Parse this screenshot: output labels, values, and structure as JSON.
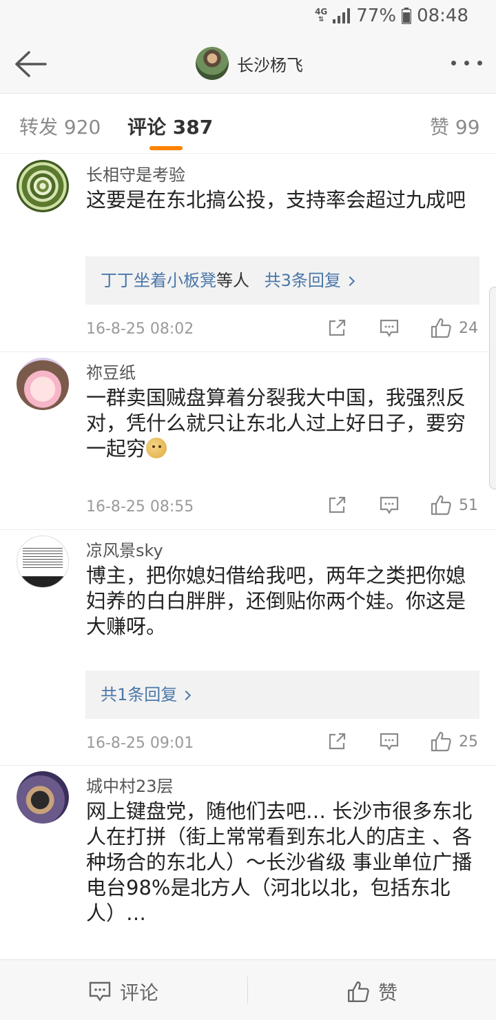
{
  "status_bar": {
    "network": "4G",
    "battery": "77%",
    "time": "08:48"
  },
  "header": {
    "title": "长沙杨飞"
  },
  "tabs": {
    "repost": "转发 920",
    "comments": "评论 387",
    "likes": "赞 99"
  },
  "comments": [
    {
      "user": "长相守是考验",
      "text": "这要是在东北搞公投，支持率会超过九成吧",
      "reply_users": "丁丁坐着小板凳",
      "reply_mid": "等人",
      "reply_count": "共3条回复",
      "time": "16-8-25 08:02",
      "likes": "24"
    },
    {
      "user": "祢豆纸",
      "text": "一群卖国贼盘算着分裂我大中国，我强烈反对，凭什么就只让东北人过上好日子，要穷一起穷",
      "time": "16-8-25 08:55",
      "likes": "51"
    },
    {
      "user": "凉风景sky",
      "text": "博主，把你媳妇借给我吧，两年之类把你媳妇养的白白胖胖，还倒贴你两个娃。你这是大赚呀。",
      "reply_count": "共1条回复",
      "time": "16-8-25 09:01",
      "likes": "25"
    },
    {
      "user": "城中村23层",
      "text": "网上键盘党，随他们去吧… 长沙市很多东北人在打拼（街上常常看到东北人的店主 、各种场合的东北人）～长沙省级 事业单位广播电台98%是北方人（河北以北，包括东北人）…"
    }
  ],
  "bottom_bar": {
    "comment": "评论",
    "like": "赞"
  },
  "colors": {
    "accent": "#ff8200",
    "link": "#4a77a8",
    "meta": "#9a9a9a"
  }
}
